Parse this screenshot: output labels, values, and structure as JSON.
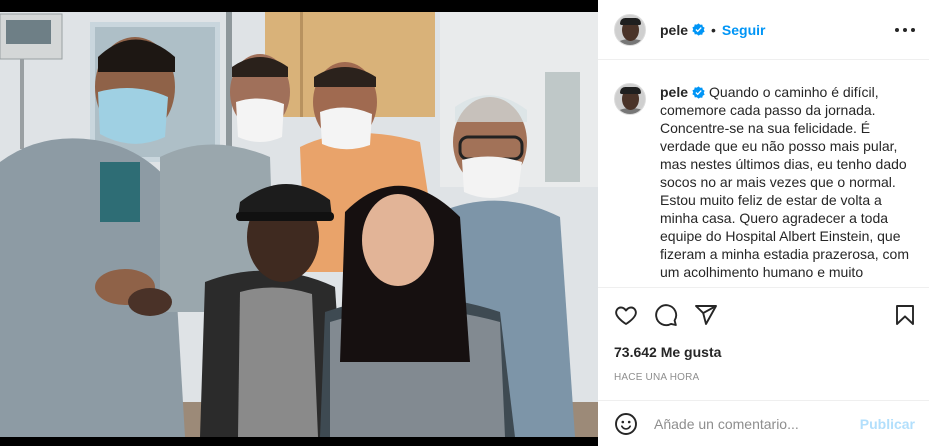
{
  "post": {
    "username": "pele",
    "follow_label": "Seguir",
    "separator": "•",
    "caption": "Quando o caminho é difícil, comemore cada passo da jornada. Concentre-se na sua felicidade. É verdade que eu não posso mais pular, mas nestes últimos dias, eu tenho dado socos no ar mais vezes que o normal. Estou muito feliz de estar de volta a minha casa. Quero agradecer a toda equipe do Hospital Albert Einstein, que fizeram a minha estadia prazerosa, com um acolhimento humano e muito",
    "likes": "73.642 Me gusta",
    "time_ago": "HACE UNA HORA"
  },
  "icons": {
    "verified": "verified-badge-icon",
    "more": "more-options-icon",
    "like": "heart-icon",
    "comment": "comment-icon",
    "share": "share-icon",
    "save": "bookmark-icon",
    "emoji": "emoji-icon"
  },
  "comment": {
    "placeholder": "Añade un comentario...",
    "publish_label": "Publicar"
  },
  "colors": {
    "accent": "#0095f6",
    "publish_disabled": "#b2dffc",
    "muted": "#8e8e8e",
    "text": "#262626"
  }
}
